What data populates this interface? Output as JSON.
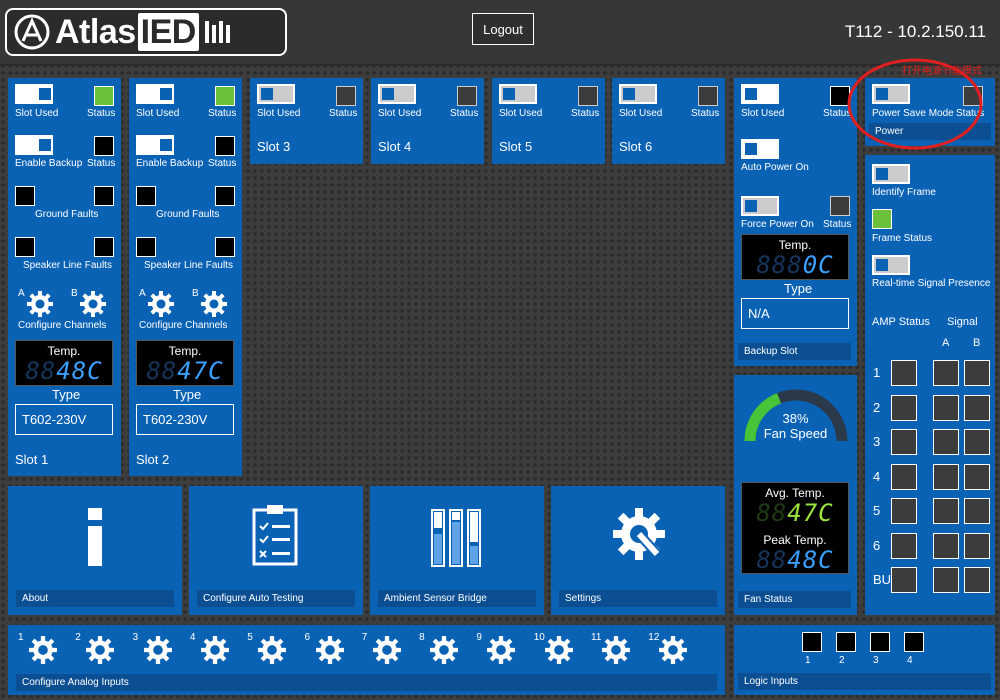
{
  "header": {
    "logo": "AtlasIED",
    "logout_label": "Logout",
    "device_title": "T112 - 10.2.150.11",
    "annotation": "打开电源节能模式"
  },
  "slots": [
    {
      "name": "Slot 1",
      "slot_used": "Slot Used",
      "status": "Status",
      "enable_backup": "Enable Backup",
      "backup_status": "Status",
      "ground_faults": "Ground Faults",
      "speaker_line_faults": "Speaker Line Faults",
      "channel_a": "A",
      "channel_b": "B",
      "configure_channels": "Configure Channels",
      "temp_label": "Temp.",
      "temp_dim": "88",
      "temp_value": "48C",
      "type_label": "Type",
      "type_value": "T602-230V"
    },
    {
      "name": "Slot 2",
      "slot_used": "Slot Used",
      "status": "Status",
      "enable_backup": "Enable Backup",
      "backup_status": "Status",
      "ground_faults": "Ground Faults",
      "speaker_line_faults": "Speaker Line Faults",
      "channel_a": "A",
      "channel_b": "B",
      "configure_channels": "Configure Channels",
      "temp_label": "Temp.",
      "temp_dim": "88",
      "temp_value": "47C",
      "type_label": "Type",
      "type_value": "T602-230V"
    },
    {
      "name": "Slot 3",
      "slot_used": "Slot Used",
      "status": "Status"
    },
    {
      "name": "Slot 4",
      "slot_used": "Slot Used",
      "status": "Status"
    },
    {
      "name": "Slot 5",
      "slot_used": "Slot Used",
      "status": "Status"
    },
    {
      "name": "Slot 6",
      "slot_used": "Slot Used",
      "status": "Status"
    }
  ],
  "backup_slot": {
    "slot_used": "Slot Used",
    "status": "Status",
    "auto_power_on": "Auto Power On",
    "force_power_on": "Force Power On",
    "force_status": "Status",
    "temp_label": "Temp.",
    "temp_dim": "888",
    "temp_value": "0C",
    "type_label": "Type",
    "type_value": "N/A",
    "title": "Backup Slot"
  },
  "power": {
    "power_save_mode": "Power Save Mode",
    "status": "Status",
    "title": "Power"
  },
  "frame": {
    "identify_frame": "Identify Frame",
    "frame_status": "Frame Status",
    "signal_presence": "Real-time Signal Presence",
    "amp_status": "AMP Status",
    "signal": "Signal",
    "col_a": "A",
    "col_b": "B",
    "rows": [
      "1",
      "2",
      "3",
      "4",
      "5",
      "6",
      "BU"
    ]
  },
  "fan": {
    "percent": "38%",
    "percent_value": 38,
    "label": "Fan Speed",
    "avg_label": "Avg. Temp.",
    "avg_dim": "88",
    "avg_value": "47C",
    "peak_label": "Peak Temp.",
    "peak_dim": "88",
    "peak_value": "48C",
    "title": "Fan Status"
  },
  "tiles": {
    "about": "About",
    "auto_testing": "Configure Auto Testing",
    "ambient": "Ambient Sensor Bridge",
    "settings": "Settings"
  },
  "analog": {
    "title": "Configure Analog Inputs",
    "inputs": [
      "1",
      "2",
      "3",
      "4",
      "5",
      "6",
      "7",
      "8",
      "9",
      "10",
      "11",
      "12"
    ]
  },
  "logic": {
    "title": "Logic Inputs",
    "inputs": [
      "1",
      "2",
      "3",
      "4"
    ]
  },
  "colors": {
    "panel": "#0a62b5",
    "accent_green": "#6cc13a",
    "annotation": "#e02020"
  }
}
